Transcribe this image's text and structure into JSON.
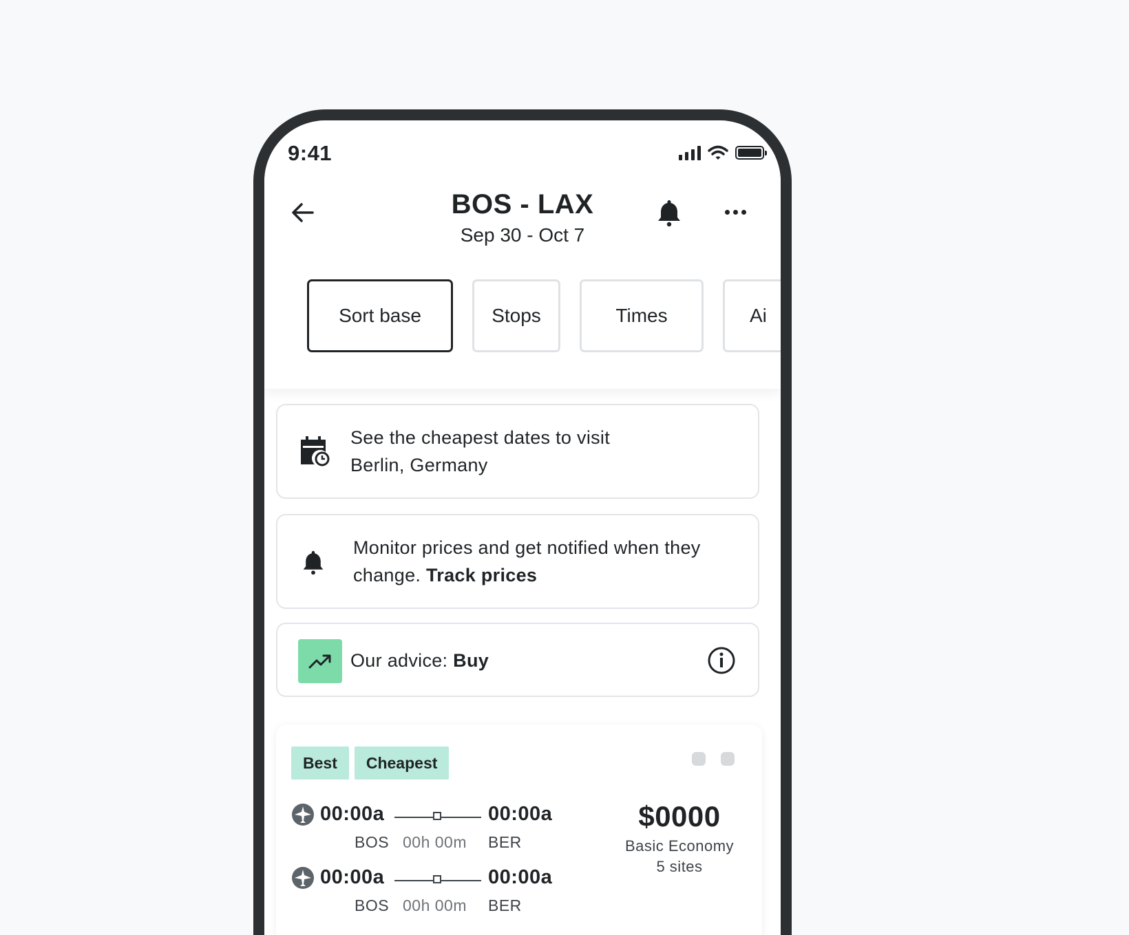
{
  "status_bar": {
    "time": "9:41"
  },
  "header": {
    "route": "BOS - LAX",
    "dates": "Sep 30 - Oct 7"
  },
  "filters": [
    {
      "label": "Sort base",
      "active": true
    },
    {
      "label": "Stops",
      "active": false
    },
    {
      "label": "Times",
      "active": false
    },
    {
      "label": "Ai",
      "active": false
    }
  ],
  "cheap_dates": {
    "line1": "See the cheapest dates to visit",
    "line2": "Berlin, Germany"
  },
  "monitor": {
    "text": "Monitor prices and get notified when they change.",
    "link": "Track prices"
  },
  "advice": {
    "label": "Our advice:",
    "value": "Buy"
  },
  "result": {
    "tags": [
      "Best",
      "Cheapest"
    ],
    "legs": [
      {
        "depart": "00:00a",
        "arrive": "00:00a",
        "from": "BOS",
        "duration": "00h 00m",
        "to": "BER"
      },
      {
        "depart": "00:00a",
        "arrive": "00:00a",
        "from": "BOS",
        "duration": "00h 00m",
        "to": "BER"
      }
    ],
    "price": "$0000",
    "cabin": "Basic Economy",
    "sites": "5 sites"
  },
  "colors": {
    "accent_green": "#7ddbaa",
    "tag_bg": "#b9eadb",
    "frame": "#2c3033"
  }
}
